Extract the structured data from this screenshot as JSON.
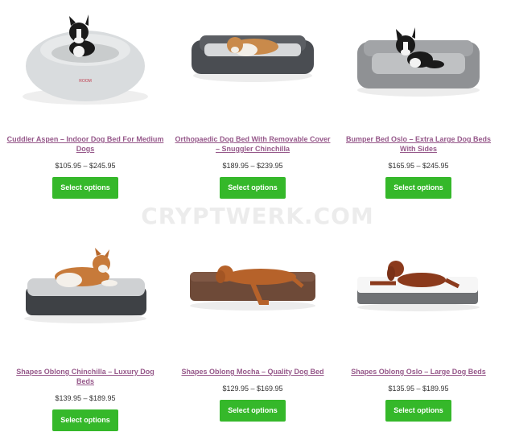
{
  "watermark": "CRYPTWERK.COM",
  "products": [
    {
      "title": "Cuddler Aspen – Indoor Dog Bed For Medium Dogs",
      "price": "$105.95 – $245.95",
      "button": "Select options",
      "image": "round-plush-bed-with-boston-terrier"
    },
    {
      "title": "Orthopaedic Dog Bed With Removable Cover – Snuggler Chinchilla",
      "price": "$189.95 – $239.95",
      "button": "Select options",
      "image": "dark-grey-bolster-bed-with-collie"
    },
    {
      "title": "Bumper Bed Oslo – Extra Large Dog Beds With Sides",
      "price": "$165.95 – $245.95",
      "button": "Select options",
      "image": "grey-bumper-bed-with-boston-terrier"
    },
    {
      "title": "Shapes Oblong Chinchilla – Luxury Dog Beds",
      "price": "$139.95 – $189.95",
      "button": "Select options",
      "image": "grey-cushion-bed-with-collie"
    },
    {
      "title": "Shapes Oblong Mocha – Quality Dog Bed",
      "price": "$129.95 – $169.95",
      "button": "Select options",
      "image": "brown-cushion-bed-with-vizsla"
    },
    {
      "title": "Shapes Oblong Oslo – Large Dog Beds",
      "price": "$135.95 – $189.95",
      "button": "Select options",
      "image": "white-cushion-bed-with-red-setter"
    }
  ]
}
